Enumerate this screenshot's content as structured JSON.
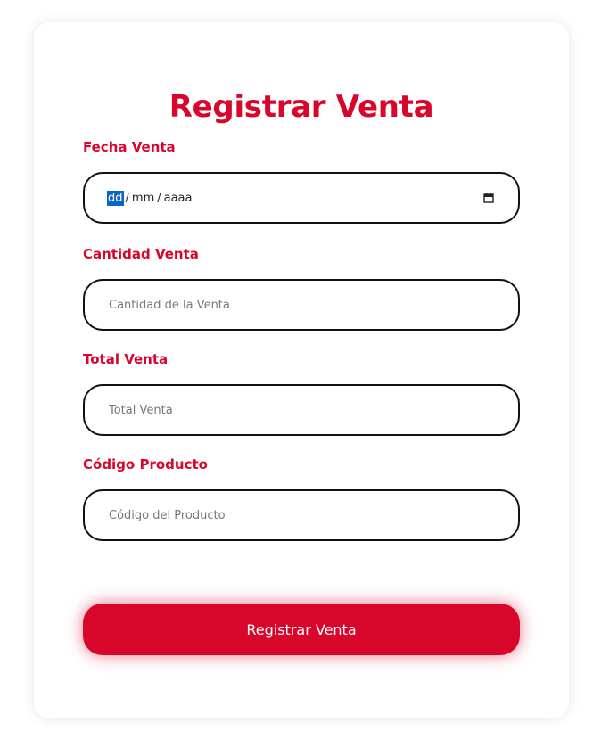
{
  "form": {
    "title": "Registrar Venta",
    "fecha": {
      "label": "Fecha Venta",
      "day_placeholder": "dd",
      "month_placeholder": "mm",
      "year_placeholder": "aaaa",
      "separator": "/"
    },
    "cantidad": {
      "label": "Cantidad Venta",
      "placeholder": "Cantidad de la Venta"
    },
    "total": {
      "label": "Total Venta",
      "placeholder": "Total Venta"
    },
    "codigo": {
      "label": "Código Producto",
      "placeholder": "Código del Producto"
    },
    "submit_label": "Registrar Venta"
  },
  "colors": {
    "accent": "#d9062c",
    "border": "#111111",
    "selection": "#0a66c2"
  }
}
